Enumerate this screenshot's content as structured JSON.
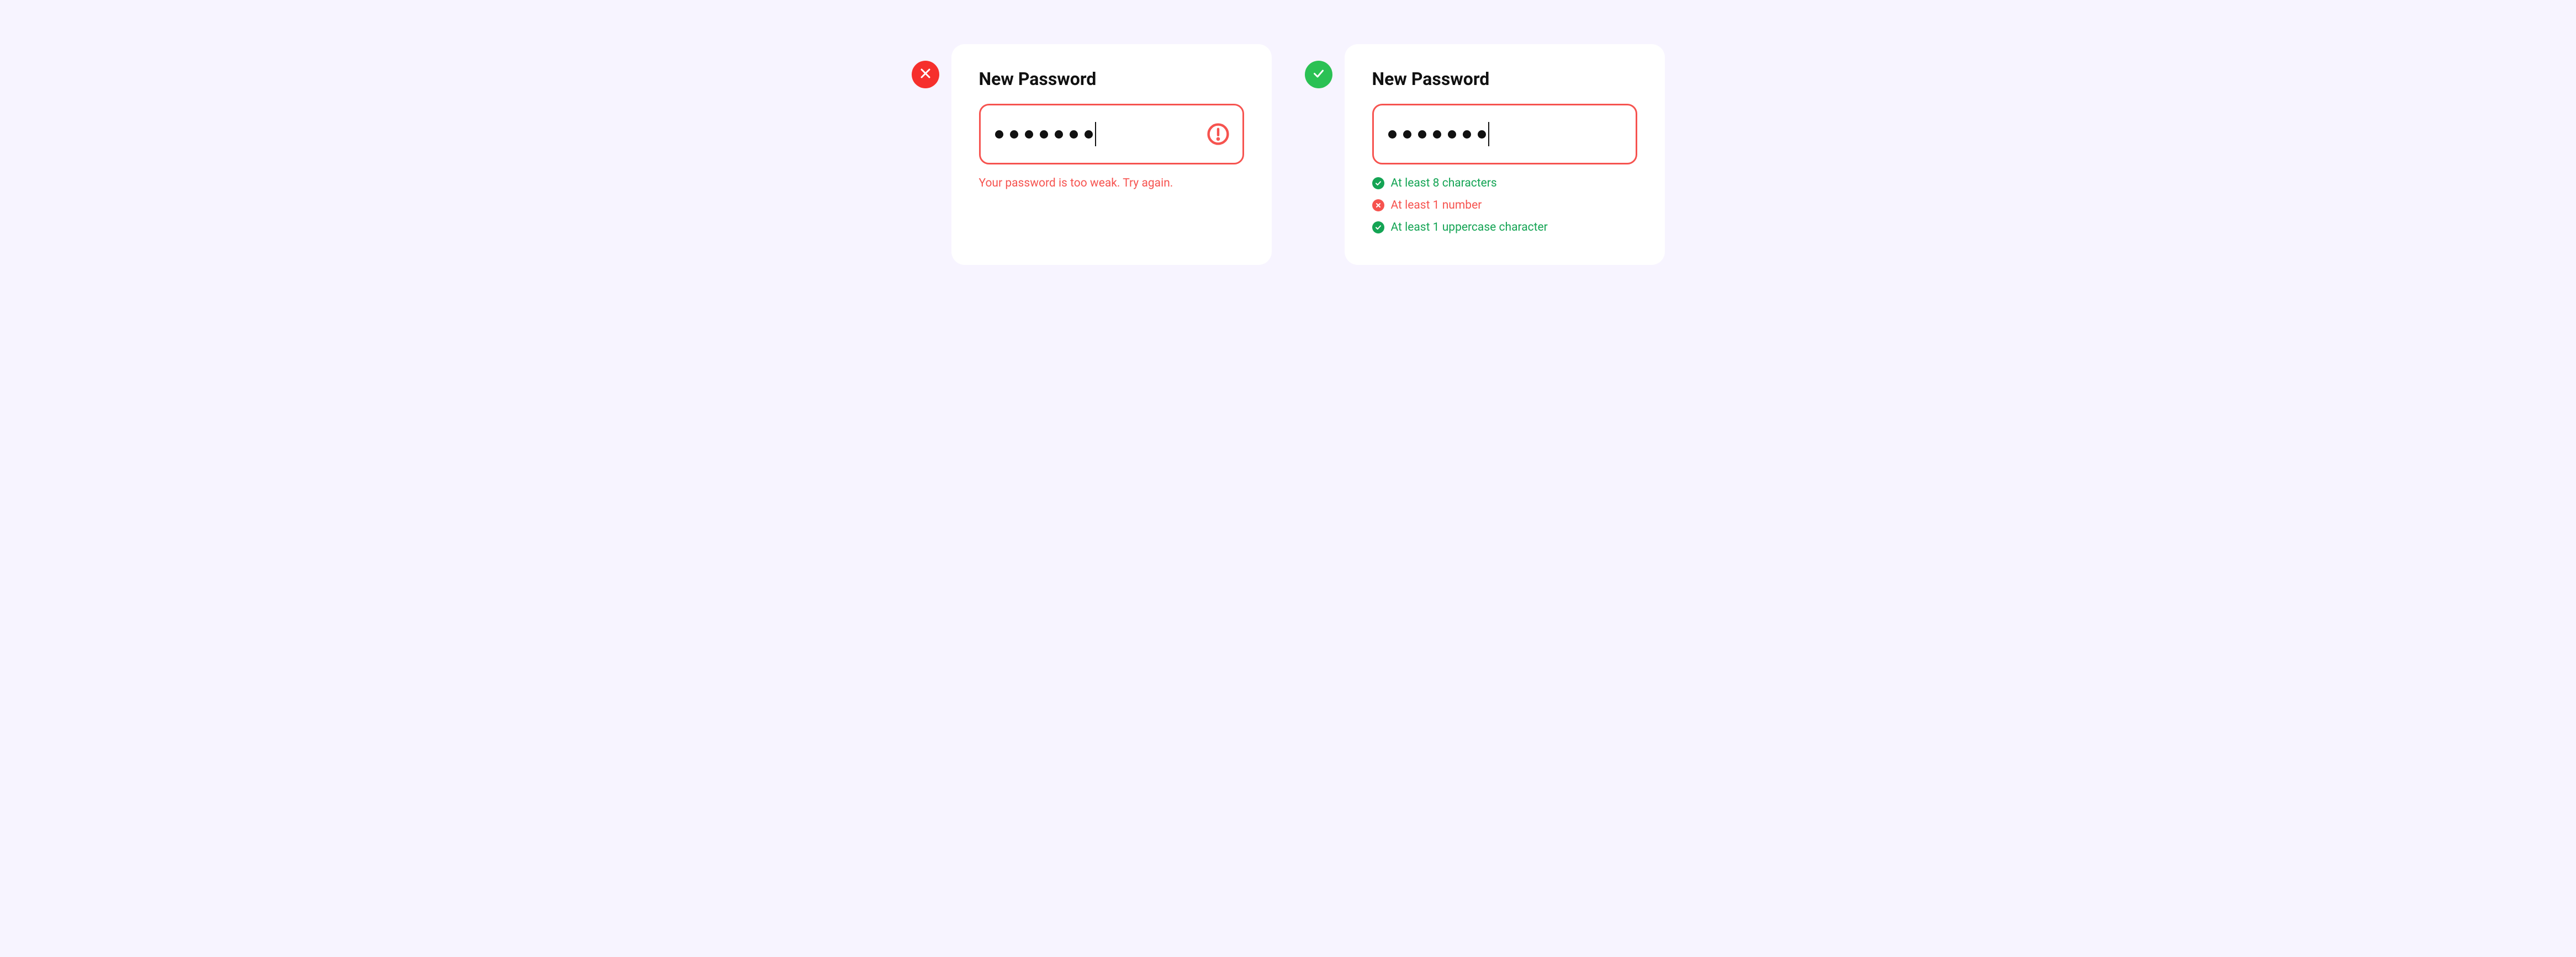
{
  "colors": {
    "error": "#f6534f",
    "success": "#14a454",
    "badge_bad": "#f62f2c",
    "badge_good": "#2bc154"
  },
  "bad_example": {
    "heading": "New Password",
    "password_dots": 7,
    "error_message": "Your password is too weak. Try again."
  },
  "good_example": {
    "heading": "New Password",
    "password_dots": 7,
    "criteria": [
      {
        "label": "At least 8 characters",
        "status": "ok"
      },
      {
        "label": "At least 1 number",
        "status": "fail"
      },
      {
        "label": "At least 1 uppercase character",
        "status": "ok"
      }
    ]
  }
}
